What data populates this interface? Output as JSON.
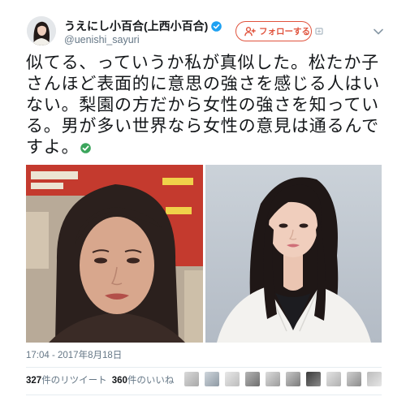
{
  "user": {
    "display_name": "うえにし小百合(上西小百合)",
    "handle": "@uenishi_sayuri",
    "avatar_icon": "profile-avatar",
    "verified_icon": "verified-badge-icon"
  },
  "header": {
    "follow_label": "フォローする",
    "follow_icon": "person-add-icon",
    "small_icon": "small-action-icon",
    "menu_icon": "chevron-down-icon"
  },
  "tweet": {
    "text": "似てる、っていうか私が真似した。松たか子さんほど表面的に意思の強さを感じる人はいない。梨園の方だから女性の強さを知っている。男が多い世界なら女性の意見は通るんですよ。",
    "emoji_icon": "check-mark-emoji-icon",
    "timestamp": "17:04 - 2017年8月18日"
  },
  "stats": {
    "retweets_count": "327",
    "retweets_label": "件のリツイート",
    "likes_count": "360",
    "likes_label": "件のいいね"
  },
  "colors": {
    "text": "#14171a",
    "muted": "#657786",
    "accent": "#e0533d",
    "verified": "#1da1f2",
    "emoji_green": "#3ba55c",
    "divider": "#e6ecf0"
  }
}
